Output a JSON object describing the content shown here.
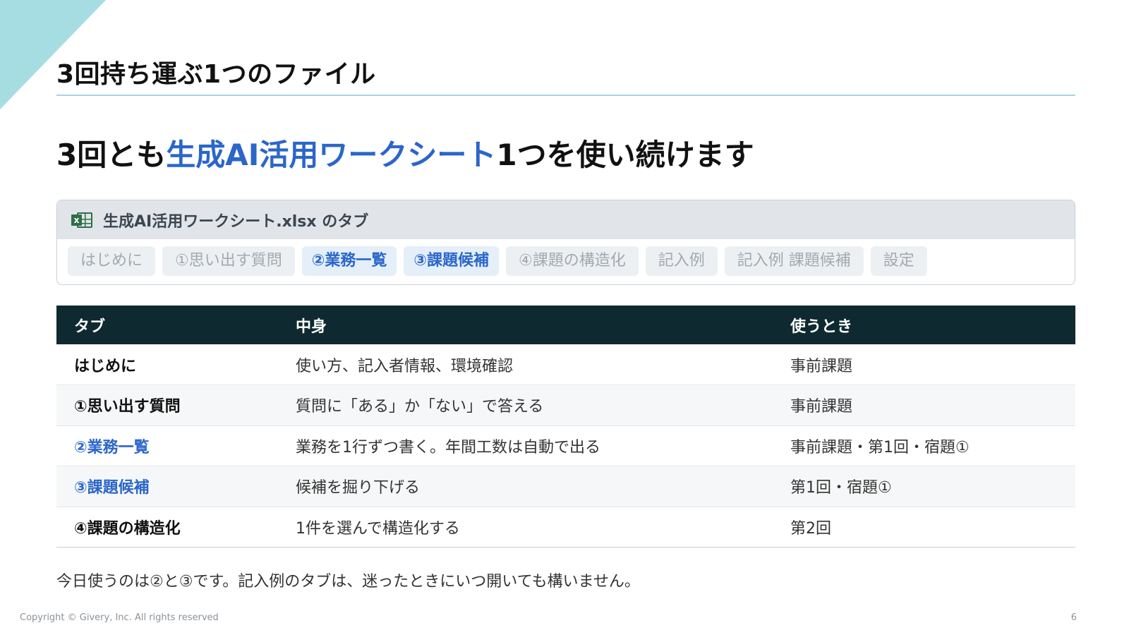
{
  "slide": {
    "title": "3回持ち運ぶ1つのファイル",
    "headline_pre": "3回とも",
    "headline_highlight": "生成AI活用ワークシート",
    "headline_post": "1つを使い続けます",
    "accent_color": "#2b66c9"
  },
  "tabs_card": {
    "icon": "excel-icon",
    "title": "生成AI活用ワークシート.xlsx のタブ",
    "tabs": [
      {
        "label": "はじめに",
        "active": false
      },
      {
        "label": "①思い出す質問",
        "active": false
      },
      {
        "label": "②業務一覧",
        "active": true
      },
      {
        "label": "③課題候補",
        "active": true
      },
      {
        "label": "④課題の構造化",
        "active": false
      },
      {
        "label": "記入例",
        "active": false
      },
      {
        "label": "記入例 課題候補",
        "active": false
      },
      {
        "label": "設定",
        "active": false
      }
    ]
  },
  "table": {
    "headers": [
      "タブ",
      "中身",
      "使うとき"
    ],
    "rows": [
      {
        "tab": "はじめに",
        "content": "使い方、記入者情報、環境確認",
        "when": "事前課題",
        "highlight": false
      },
      {
        "tab": "①思い出す質問",
        "content": "質問に「ある」か「ない」で答える",
        "when": "事前課題",
        "highlight": false
      },
      {
        "tab": "②業務一覧",
        "content": "業務を1行ずつ書く。年間工数は自動で出る",
        "when": "事前課題・第1回・宿題①",
        "highlight": true
      },
      {
        "tab": "③課題候補",
        "content": "候補を掘り下げる",
        "when": "第1回・宿題①",
        "highlight": true
      },
      {
        "tab": "④課題の構造化",
        "content": "1件を選んで構造化する",
        "when": "第2回",
        "highlight": false
      }
    ]
  },
  "note": "今日使うのは②と③です。記入例のタブは、迷ったときにいつ開いても構いません。",
  "footer": {
    "copyright": "Copyright © Givery, Inc. All rights reserved",
    "page_number": "6"
  }
}
